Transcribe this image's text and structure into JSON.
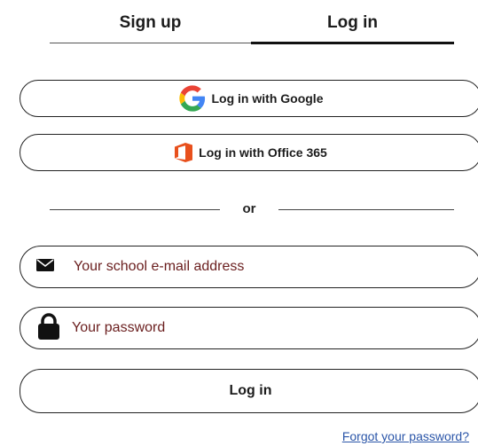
{
  "tabs": {
    "signup": "Sign up",
    "login": "Log in",
    "active": "login"
  },
  "oauth": {
    "google_label": "Log in with Google",
    "google_icon": "google-icon",
    "office_label": "Log in with Office 365",
    "office_icon": "office-365-icon"
  },
  "divider": {
    "text": "or"
  },
  "form": {
    "email_placeholder": "Your school e-mail address",
    "email_icon": "envelope-icon",
    "password_placeholder": "Your password",
    "password_icon": "lock-icon",
    "submit_label": "Log in",
    "forgot_link": "Forgot your password?"
  },
  "colors": {
    "placeholder": "#6a1e1e",
    "link": "#2a55a8",
    "office_orange": "#e8501c",
    "google_blue": "#4285f4",
    "google_red": "#ea4335",
    "google_yellow": "#fbbc05",
    "google_green": "#34a853"
  }
}
